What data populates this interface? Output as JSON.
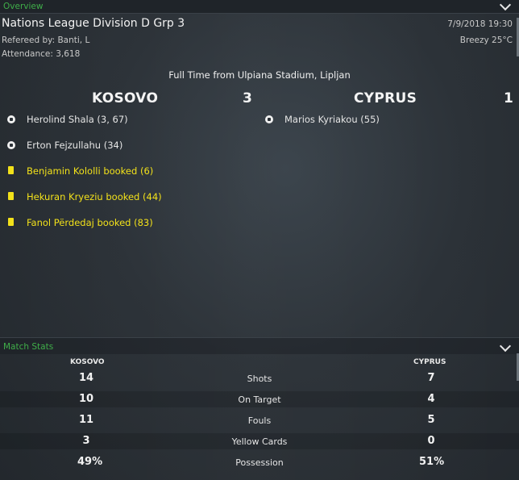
{
  "overview": {
    "label": "Overview"
  },
  "match": {
    "title": "Nations League Division D Grp 3",
    "referee": "Refereed by: Banti, L",
    "attendance": "Attendance: 3,618",
    "datetime": "7/9/2018 19:30",
    "weather": "Breezy 25°C",
    "venue": "Full Time from Ulpiana Stadium, Lipljan"
  },
  "home": {
    "name": "KOSOVO",
    "score": "3",
    "events": [
      {
        "type": "goal",
        "text": "Herolind Shala (3, 67)"
      },
      {
        "type": "goal",
        "text": "Erton Fejzullahu (34)"
      },
      {
        "type": "yellow-card",
        "text": "Benjamin Kololli booked (6)"
      },
      {
        "type": "yellow-card",
        "text": "Hekuran Kryeziu booked (44)"
      },
      {
        "type": "yellow-card",
        "text": "Fanol Përdedaj booked (83)"
      }
    ]
  },
  "away": {
    "name": "CYPRUS",
    "score": "1",
    "events": [
      {
        "type": "goal",
        "text": "Marios Kyriakou (55)"
      }
    ]
  },
  "stats": {
    "label": "Match Stats",
    "home_team": "KOSOVO",
    "away_team": "CYPRUS",
    "rows": [
      {
        "name": "Shots",
        "home": "14",
        "away": "7"
      },
      {
        "name": "On Target",
        "home": "10",
        "away": "4"
      },
      {
        "name": "Fouls",
        "home": "11",
        "away": "5"
      },
      {
        "name": "Yellow Cards",
        "home": "3",
        "away": "0"
      },
      {
        "name": "Possession",
        "home": "49%",
        "away": "51%"
      }
    ]
  },
  "colors": {
    "accent": "#3fae49",
    "card": "#f2e11a",
    "background": "#2b3137"
  }
}
